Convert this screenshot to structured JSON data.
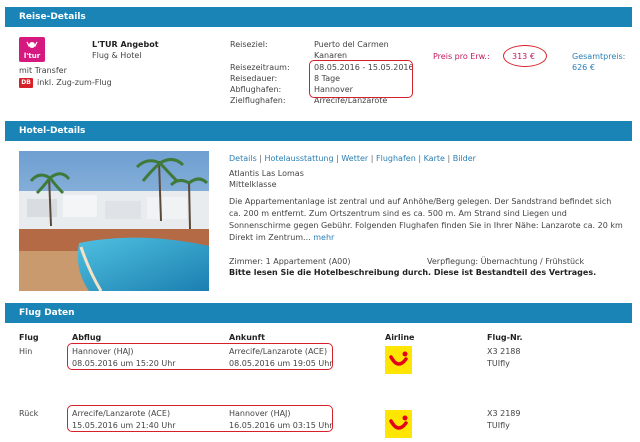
{
  "reise": {
    "header": "Reise-Details",
    "ltur_logo": "l'tur",
    "angebot": "L'TUR Angebot",
    "angebot_typ": "Flug & Hotel",
    "transfer": "mit Transfer",
    "db_logo": "DB",
    "zug": "inkl. Zug-zum-Flug",
    "labels": {
      "reiseziel": "Reiseziel:",
      "reisezeitraum": "Reisezeitraum:",
      "reisedauer": "Reisedauer:",
      "abflughafen": "Abflughafen:",
      "zielflughafen": "Zielflughafen:"
    },
    "reiseziel_1": "Puerto del Carmen",
    "reiseziel_2": "Kanaren",
    "reisezeitraum": "08.05.2016 - 15.05.2016",
    "reisedauer": "8 Tage",
    "abflughafen": "Hannover",
    "zielflughafen": "Arrecife/Lanzarote",
    "preis_label": "Preis pro Erw.:",
    "preis": "313 €",
    "gesamtpreis_label": "Gesamtpreis:",
    "gesamtpreis": "626 €"
  },
  "hotel": {
    "header": "Hotel-Details",
    "links": [
      "Details",
      "Hotelausstattung",
      "Wetter",
      "Flughafen",
      "Karte",
      "Bilder"
    ],
    "name": "Atlantis Las Lomas",
    "klasse": "Mittelklasse",
    "beschreibung": "Die Appartementanlage ist zentral und auf Anhöhe/Berg gelegen. Der Sandstrand befindet sich ca. 200 m entfernt. Zum Ortszentrum sind es ca. 500 m. Am Strand sind Liegen und Sonnenschirme gegen Gebühr. Folgenden Flughafen finden Sie in Ihrer Nähe: Lanzarote ca. 20 km Direkt im Zentrum...",
    "mehr": "mehr",
    "zimmer": "Zimmer: 1 Appartement (A00)",
    "verpflegung": "Verpflegung: Übernachtung / Frühstück",
    "hinweis": "Bitte lesen Sie die Hotelbeschreibung durch. Diese ist Bestandteil des Vertrages."
  },
  "flug": {
    "header": "Flug Daten",
    "columns": [
      "Flug",
      "Abflug",
      "Ankunft",
      "Airline",
      "Flug-Nr."
    ],
    "rows": [
      {
        "flug": "Hin",
        "abflug_ort": "Hannover (HAJ)",
        "abflug_zeit": "08.05.2016 um 15:20 Uhr",
        "ankunft_ort": "Arrecife/Lanzarote (ACE)",
        "ankunft_zeit": "08.05.2016 um 19:05 Uhr",
        "nr": "X3 2188",
        "airline": "TUIfly"
      },
      {
        "flug": "Rück",
        "abflug_ort": "Arrecife/Lanzarote (ACE)",
        "abflug_zeit": "15.05.2016 um 21:40 Uhr",
        "ankunft_ort": "Hannover (HAJ)",
        "ankunft_zeit": "16.05.2016 um 03:15 Uhr",
        "nr": "X3 2189",
        "airline": "TUIfly"
      }
    ]
  },
  "colors": {
    "header_bar": "#1b84b6",
    "highlight": "#d8202a",
    "price": "#c2185b",
    "link": "#2a7fb3",
    "tui_yellow": "#ffe600",
    "tui_red": "#e2001a"
  },
  "icons": {
    "ltur": "ltur-logo-icon",
    "db": "db-logo-icon",
    "tui": "tui-logo-icon"
  }
}
